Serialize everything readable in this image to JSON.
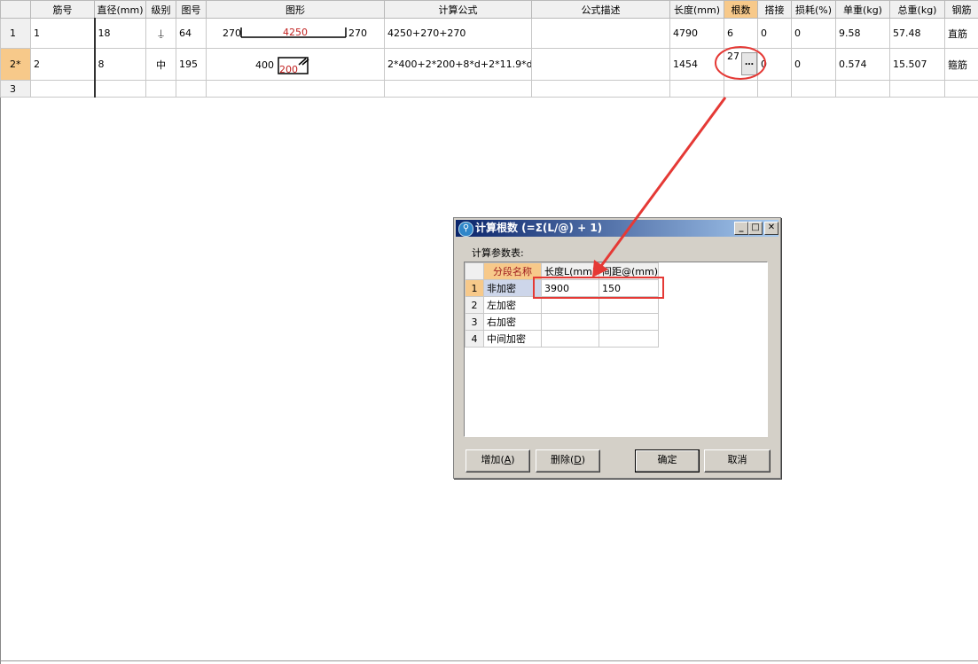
{
  "grid": {
    "headers": [
      "筋号",
      "直径(mm)",
      "级别",
      "图号",
      "图形",
      "计算公式",
      "公式描述",
      "长度(mm)",
      "根数",
      "搭接",
      "损耗(%)",
      "单重(kg)",
      "总重(kg)",
      "钢筋"
    ],
    "rows": [
      {
        "rownum": "1",
        "bar_no": "1",
        "diameter": "18",
        "grade": "⍊",
        "fig_no": "64",
        "shape_left": "270",
        "shape_mid": "4250",
        "shape_right": "270",
        "formula": "4250+270+270",
        "desc": "",
        "length": "4790",
        "count": "6",
        "lap": "0",
        "loss": "0",
        "unit_w": "9.58",
        "total_w": "57.48",
        "type": "直筋"
      },
      {
        "rownum": "2*",
        "bar_no": "2",
        "diameter": "8",
        "grade": "中",
        "fig_no": "195",
        "shape_left": "400",
        "shape_mid": "200",
        "formula": "2*400+2*200+8*d+2*11.9*d",
        "desc": "",
        "length": "1454",
        "count": "27",
        "lap": "0",
        "loss": "0",
        "unit_w": "0.574",
        "total_w": "15.507",
        "type": "箍筋"
      },
      {
        "rownum": "3"
      }
    ],
    "ellipsis": "…"
  },
  "dialog": {
    "title": "计算根数 (=Σ(L/@) + 1)",
    "minimize": "_",
    "maximize": "□",
    "close": "✕",
    "params_label": "计算参数表:",
    "columns": [
      "分段名称",
      "长度L(mm)",
      "间距@(mm)"
    ],
    "rows": [
      {
        "n": "1",
        "name": "非加密",
        "length": "3900",
        "spacing": "150"
      },
      {
        "n": "2",
        "name": "左加密",
        "length": "",
        "spacing": ""
      },
      {
        "n": "3",
        "name": "右加密",
        "length": "",
        "spacing": ""
      },
      {
        "n": "4",
        "name": "中间加密",
        "length": "",
        "spacing": ""
      }
    ],
    "buttons": {
      "add": "增加",
      "add_key": "A",
      "delete": "删除",
      "delete_key": "D",
      "ok": "确定",
      "cancel": "取消"
    }
  },
  "colors": {
    "highlight_header": "#f7c98a",
    "annotation_red": "#e53935",
    "title_bar": "#0a246a"
  }
}
